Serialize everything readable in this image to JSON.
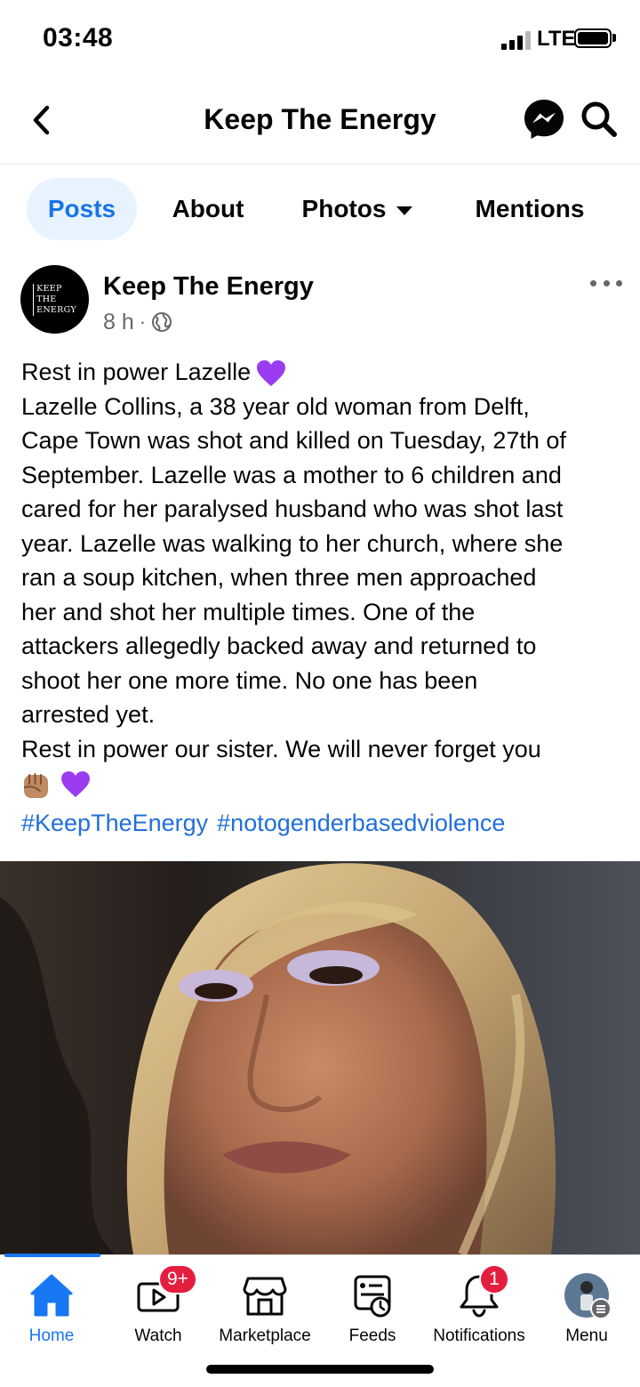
{
  "status_bar": {
    "time": "03:48",
    "network": "LTE"
  },
  "header": {
    "title": "Keep The Energy"
  },
  "tabs": [
    {
      "label": "Posts",
      "active": true
    },
    {
      "label": "About"
    },
    {
      "label": "Photos"
    },
    {
      "label": "Mentions"
    }
  ],
  "post": {
    "avatar_text": [
      "KEEP",
      "THE",
      "ENERGY"
    ],
    "author": "Keep The Energy",
    "time": "8 h",
    "separator": "·",
    "body_lines": [
      "Rest in power Lazelle",
      "Lazelle Collins, a 38 year old woman from Delft,",
      "Cape Town was shot and killed on Tuesday, 27th of",
      "September. Lazelle was a mother to 6 children and",
      "cared for her paralysed husband who was shot last",
      "year. Lazelle was walking to her church, where she",
      "ran a soup kitchen, when three men approached",
      "her and shot her multiple times. One of the",
      "attackers allegedly backed away and returned to",
      "shoot her one more time. No one has been",
      "arrested yet.",
      "Rest in power our sister. We will never forget you"
    ],
    "hashtags": [
      "#KeepTheEnergy",
      "#notogenderbasedviolence"
    ]
  },
  "bottom_nav": [
    {
      "label": "Home",
      "icon": "home-icon",
      "active": true
    },
    {
      "label": "Watch",
      "icon": "watch-icon",
      "badge": "9+"
    },
    {
      "label": "Marketplace",
      "icon": "marketplace-icon"
    },
    {
      "label": "Feeds",
      "icon": "feeds-icon"
    },
    {
      "label": "Notifications",
      "icon": "bell-icon",
      "badge": "1"
    },
    {
      "label": "Menu",
      "icon": "menu-avatar"
    }
  ],
  "colors": {
    "accent": "#1877f2",
    "tab_active_bg": "#e7f3ff",
    "link": "#216fdb",
    "badge": "#e41e3f",
    "heart": "#9b3cf0"
  }
}
